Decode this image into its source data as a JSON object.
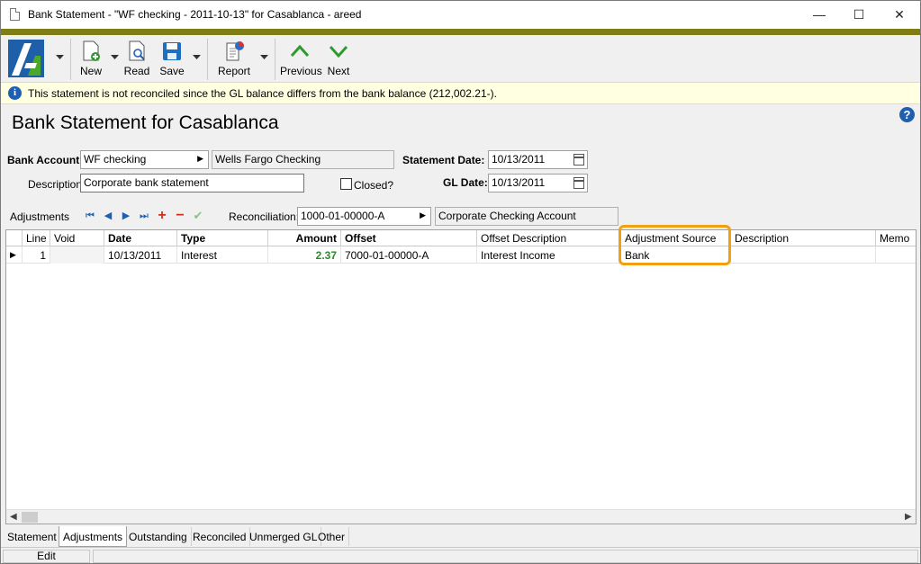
{
  "window": {
    "title": "Bank Statement - \"WF checking - 2011-10-13\" for Casablanca - areed",
    "minimize": "—",
    "maximize": "☐",
    "close": "✕"
  },
  "toolbar": {
    "new_label": "New",
    "read_label": "Read",
    "save_label": "Save",
    "report_label": "Report",
    "previous_label": "Previous",
    "next_label": "Next"
  },
  "info": {
    "message": "This statement is not reconciled since the GL balance differs from the bank balance (212,002.21-)."
  },
  "page": {
    "title": "Bank Statement for Casablanca"
  },
  "form": {
    "bank_account_label": "Bank Account:",
    "bank_account_value": "WF checking",
    "bank_account_name": "Wells Fargo Checking",
    "description_label": "Description:",
    "description_value": "Corporate bank statement",
    "closed_label": "Closed?",
    "statement_date_label": "Statement Date:",
    "statement_date_value": "10/13/2011",
    "gl_date_label": "GL Date:",
    "gl_date_value": "10/13/2011"
  },
  "adjustments": {
    "label": "Adjustments",
    "reconciliation_label": "Reconciliation:",
    "reconciliation_value": "1000-01-00000-A",
    "reconciliation_name": "Corporate Checking Account"
  },
  "grid": {
    "columns": [
      "Line",
      "Void",
      "Date",
      "Type",
      "Amount",
      "Offset",
      "Offset Description",
      "Adjustment Source",
      "Description",
      "Memo"
    ],
    "rows": [
      {
        "line": "1",
        "void": "",
        "date": "10/13/2011",
        "type": "Interest",
        "amount": "2.37",
        "offset": "7000-01-00000-A",
        "offset_description": "Interest Income",
        "adjustment_source": "Bank",
        "description": "",
        "memo": ""
      }
    ]
  },
  "tabs": [
    "Statement",
    "Adjustments",
    "Outstanding",
    "Reconciled",
    "Unmerged GL",
    "Other"
  ],
  "status": {
    "mode": "Edit"
  },
  "colors": {
    "accent_bar": "#7e7d16",
    "highlight": "#f0a010",
    "amount_green": "#2a8a2a",
    "nav_blue": "#1e5fb0"
  }
}
